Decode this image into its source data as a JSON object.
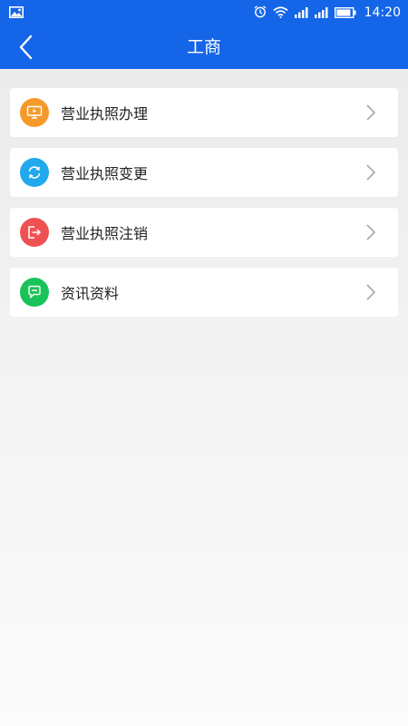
{
  "status_bar": {
    "time": "14:20",
    "icons": [
      "image-icon",
      "alarm-icon",
      "wifi-icon",
      "signal-icon",
      "signal-icon",
      "battery-icon"
    ]
  },
  "header": {
    "title": "工商",
    "back_icon": "back-arrow-icon",
    "color": "#1565e8"
  },
  "menu": {
    "items": [
      {
        "label": "营业执照办理",
        "icon": "monitor-icon",
        "color": "#f59a2a"
      },
      {
        "label": "营业执照变更",
        "icon": "refresh-icon",
        "color": "#22a8ec"
      },
      {
        "label": "营业执照注销",
        "icon": "logout-icon",
        "color": "#ef5152"
      },
      {
        "label": "资讯资料",
        "icon": "chat-icon",
        "color": "#1ac35a"
      }
    ]
  }
}
